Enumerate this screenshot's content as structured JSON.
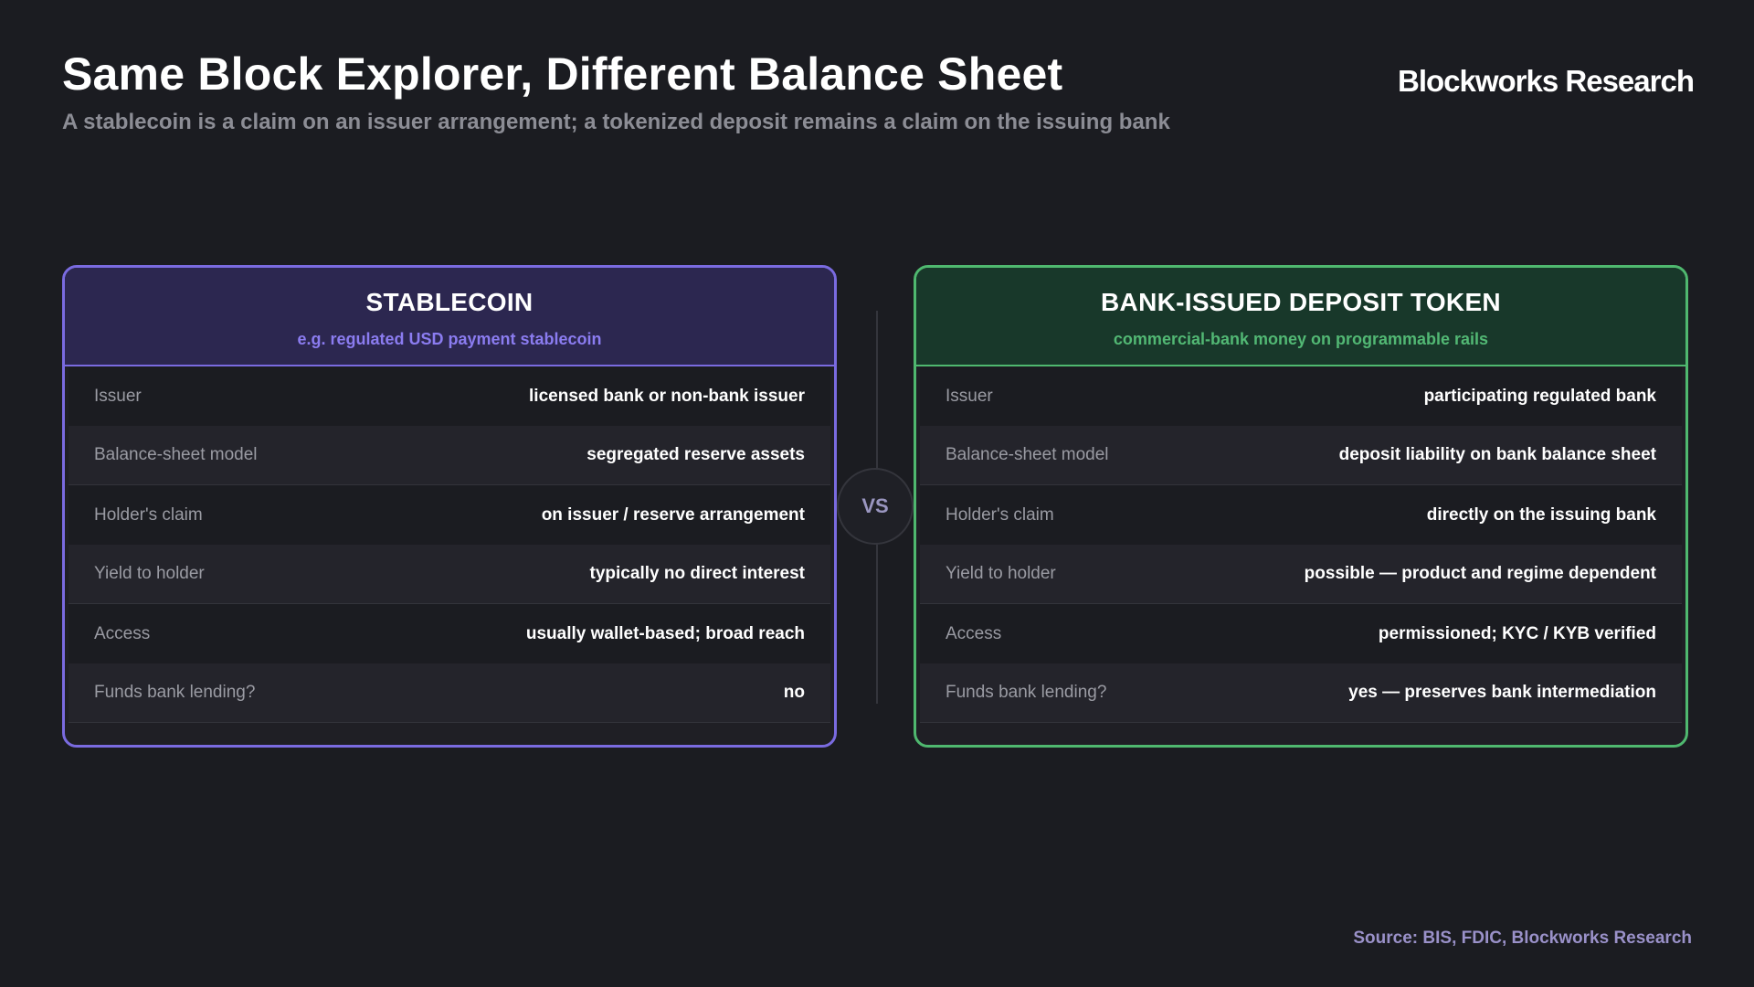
{
  "header": {
    "title": "Same Block Explorer, Different Balance Sheet",
    "subtitle": "A stablecoin is a claim on an issuer arrangement; a tokenized deposit remains a claim on the issuing bank",
    "brand": "Blockworks Research"
  },
  "colors": {
    "stablecoin_accent": "#7a6be0",
    "deposit_token_accent": "#4fb86f",
    "background": "#1b1c21"
  },
  "vs_label": "VS",
  "cards": [
    {
      "title": "STABLECOIN",
      "subtitle": "e.g. regulated USD payment stablecoin",
      "rows": [
        {
          "label": "Issuer",
          "value": "licensed bank or non-bank issuer"
        },
        {
          "label": "Balance-sheet model",
          "value": "segregated reserve assets"
        },
        {
          "label": "Holder's claim",
          "value": "on issuer / reserve arrangement"
        },
        {
          "label": "Yield to holder",
          "value": "typically no direct interest"
        },
        {
          "label": "Access",
          "value": "usually wallet-based; broad reach"
        },
        {
          "label": "Funds bank lending?",
          "value": "no"
        }
      ]
    },
    {
      "title": "BANK-ISSUED DEPOSIT TOKEN",
      "subtitle": "commercial-bank money on programmable rails",
      "rows": [
        {
          "label": "Issuer",
          "value": "participating regulated bank"
        },
        {
          "label": "Balance-sheet model",
          "value": "deposit liability on bank balance sheet"
        },
        {
          "label": "Holder's claim",
          "value": "directly on the issuing bank"
        },
        {
          "label": "Yield to holder",
          "value": "possible — product and regime dependent"
        },
        {
          "label": "Access",
          "value": "permissioned; KYC / KYB verified"
        },
        {
          "label": "Funds bank lending?",
          "value": "yes — preserves bank intermediation"
        }
      ]
    }
  ],
  "footer": {
    "source": "Source: BIS, FDIC, Blockworks Research"
  }
}
